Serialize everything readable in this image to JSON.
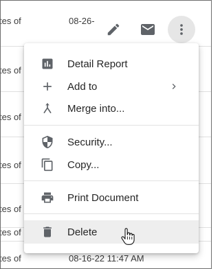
{
  "rows": [
    {
      "text": "tes of",
      "date": "08-26-"
    },
    {
      "text": "tes of"
    },
    {
      "text": "tes of"
    },
    {
      "text": "tes of"
    },
    {
      "text": "tes of"
    },
    {
      "text": "tes of"
    },
    {
      "text": "tes of",
      "date": "08-16-22 11:47 AM"
    }
  ],
  "actions": {
    "edit_icon": "pencil-icon",
    "mail_icon": "mail-icon",
    "more_icon": "more-vert-icon"
  },
  "menu": {
    "items": [
      {
        "label": "Detail Report",
        "icon": "bar-chart-icon"
      },
      {
        "label": "Add to",
        "icon": "plus-icon",
        "submenu": true
      },
      {
        "label": "Merge into...",
        "icon": "merge-icon"
      },
      {
        "label": "Security...",
        "icon": "shield-icon"
      },
      {
        "label": "Copy...",
        "icon": "copy-icon"
      },
      {
        "label": "Print Document",
        "icon": "printer-icon"
      },
      {
        "label": "Delete",
        "icon": "trash-icon",
        "hovered": true
      }
    ]
  },
  "colors": {
    "icon": "#5f6368",
    "hover": "#eeeeee",
    "more_button_bg": "#e6e6e6"
  }
}
